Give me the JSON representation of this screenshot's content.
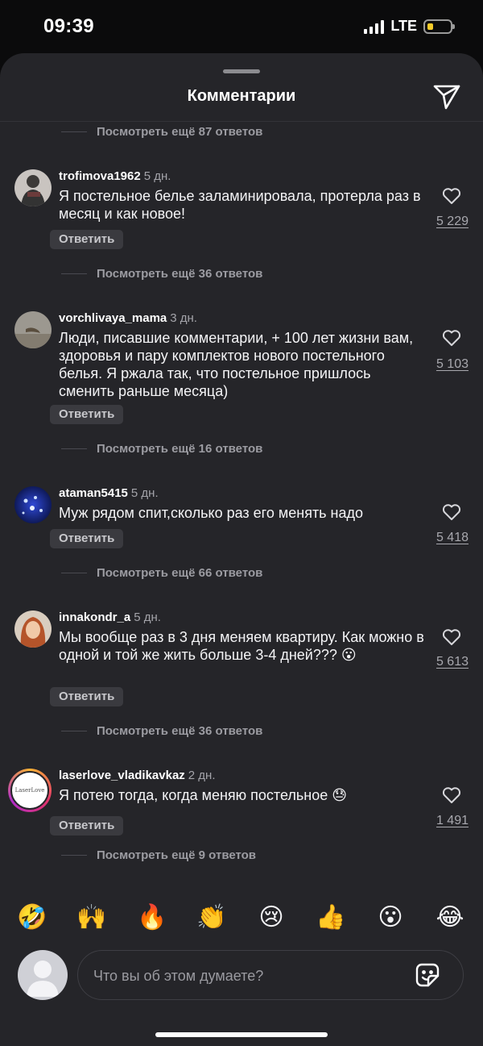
{
  "status_bar": {
    "time": "09:39",
    "network": "LTE"
  },
  "header": {
    "title": "Комментарии",
    "send_icon": "paper-plane-icon"
  },
  "top_more_replies": "Посмотреть ещё 87 ответов",
  "comments": [
    {
      "username": "trofimova1962",
      "time": "5 дн.",
      "text": "Я постельное белье заламинировала, протерла раз в месяц и как новое!",
      "reply_label": "Ответить",
      "likes": "5 229",
      "more_replies": "Посмотреть ещё 36 ответов"
    },
    {
      "username": "vorchlivaya_mama",
      "time": "3 дн.",
      "text": "Люди, писавшие комментарии, + 100 лет жизни вам, здоровья и пару комплектов нового постельного белья. Я ржала так, что постельное пришлось сменить раньше месяца)",
      "reply_label": "Ответить",
      "likes": "5 103",
      "more_replies": "Посмотреть ещё 16 ответов"
    },
    {
      "username": "ataman5415",
      "time": "5 дн.",
      "text": "Муж рядом спит,сколько раз его менять надо",
      "reply_label": "Ответить",
      "likes": "5 418",
      "more_replies": "Посмотреть ещё 66 ответов"
    },
    {
      "username": "innakondr_a",
      "time": "5 дн.",
      "text": "Мы вообще раз в 3 дня меняем квартиру. Как можно в одной и той же жить больше 3-4 дней??? 😮",
      "reply_label": "Ответить",
      "likes": "5 613",
      "more_replies": "Посмотреть ещё 36 ответов"
    },
    {
      "username": "laserlove_vladikavkaz",
      "time": "2 дн.",
      "text": "Я потею тогда, когда меняю постельное 😓",
      "reply_label": "Ответить",
      "likes": "1 491",
      "more_replies": "Посмотреть ещё 9 ответов",
      "avatar_logo_text": "LaserLove"
    }
  ],
  "quick_emojis": [
    "🤣",
    "🙌",
    "🔥",
    "👏",
    "😢",
    "👍",
    "😮",
    "😂"
  ],
  "composer": {
    "placeholder": "Что вы об этом думаете?",
    "sticker_icon": "sticker-icon"
  },
  "colors": {
    "background": "#252529",
    "accent_text": "#ffffff",
    "muted": "#9c9ca2"
  }
}
